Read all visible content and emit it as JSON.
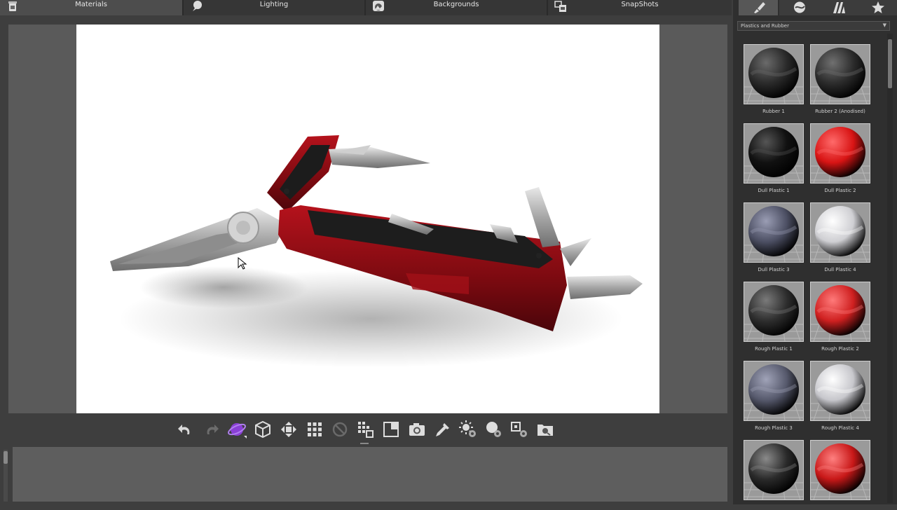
{
  "tabs": [
    {
      "label": "Materials",
      "icon": "paint-can-icon"
    },
    {
      "label": "Lighting",
      "icon": "bulb-icon"
    },
    {
      "label": "Backgrounds",
      "icon": "landscape-icon"
    },
    {
      "label": "SnapShots",
      "icon": "snapshot-icon"
    }
  ],
  "right_tabs": [
    "brush-icon",
    "sphere-icon",
    "texture-icon",
    "star-icon"
  ],
  "library": {
    "category": "Plastics and Rubber",
    "materials": [
      {
        "name": "Rubber 1",
        "base": "#2a2a2a",
        "hi": "#6a6a6a"
      },
      {
        "name": "Rubber 2 (Anodised)",
        "base": "#2c2c2c",
        "hi": "#707070"
      },
      {
        "name": "Dull Plastic 1",
        "base": "#111111",
        "hi": "#555555"
      },
      {
        "name": "Dull Plastic 2",
        "base": "#d81414",
        "hi": "#ff6a6a"
      },
      {
        "name": "Dull Plastic 3",
        "base": "#4c4f63",
        "hi": "#9a9db4"
      },
      {
        "name": "Dull Plastic 4",
        "base": "#cfcfd3",
        "hi": "#ffffff"
      },
      {
        "name": "Rough Plastic 1",
        "base": "#2e2e2e",
        "hi": "#7a7a7a"
      },
      {
        "name": "Rough Plastic 2",
        "base": "#cf2020",
        "hi": "#ff7a7a"
      },
      {
        "name": "Rough Plastic 3",
        "base": "#56596c",
        "hi": "#a0a3b8"
      },
      {
        "name": "Rough Plastic 4",
        "base": "#c7c7cc",
        "hi": "#ffffff"
      },
      {
        "name": "",
        "base": "#2a2a2a",
        "hi": "#8a8a8a"
      },
      {
        "name": "",
        "base": "#c81818",
        "hi": "#ff8080"
      }
    ]
  },
  "toolbar": [
    "undo-icon",
    "redo-icon",
    "rotate-model-icon",
    "cube-icon",
    "move-icon",
    "grid-icon",
    "disable-icon",
    "display-mode-icon",
    "region-icon",
    "camera-icon",
    "eyedropper-icon",
    "light-settings-icon",
    "material-settings-icon",
    "render-settings-icon",
    "zoom-icon"
  ],
  "colors": {
    "accent_purple": "#8a3fd6",
    "tool_body_red": "#8a0d14",
    "viewport_bg": "#ffffff"
  }
}
